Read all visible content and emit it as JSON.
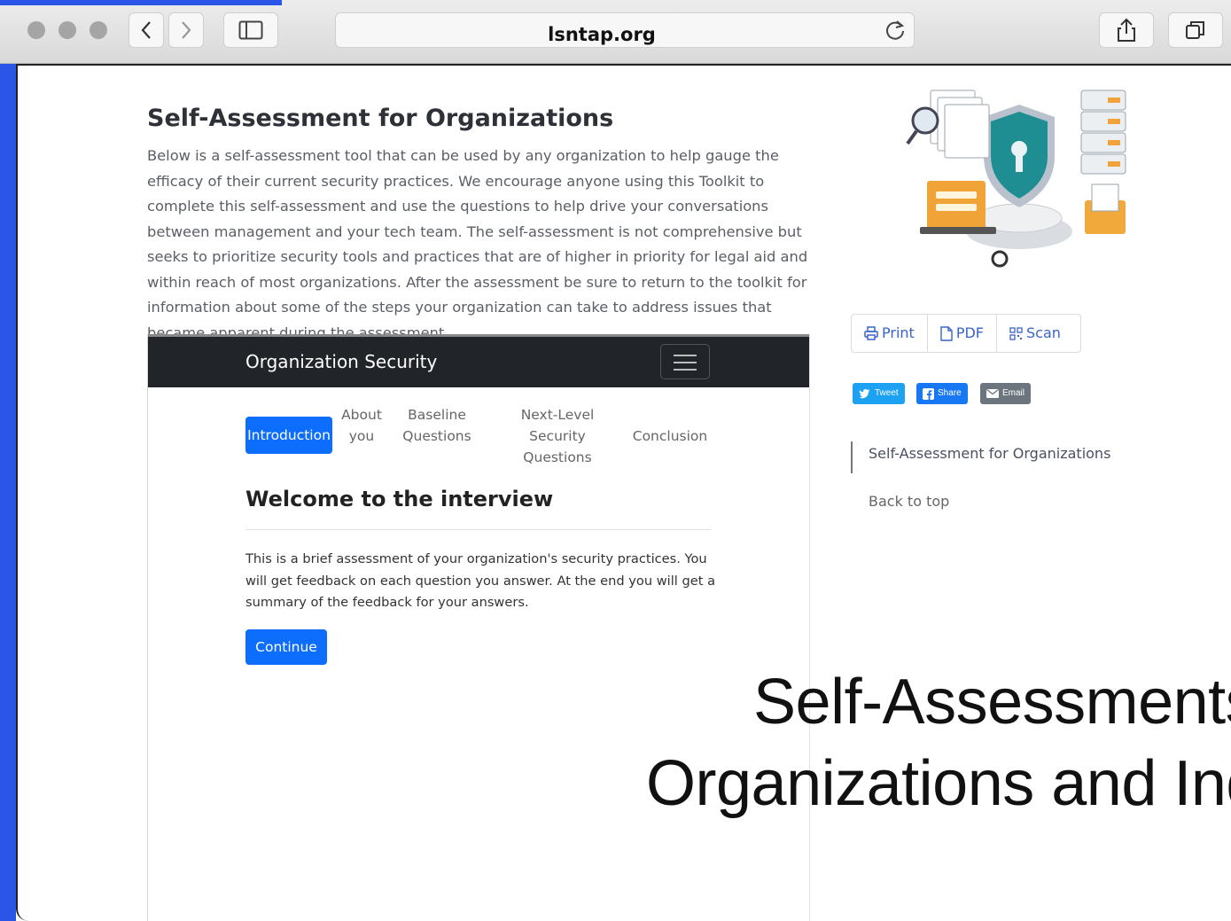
{
  "browser": {
    "url": "lsntap.org"
  },
  "article": {
    "title": "Self-Assessment for Organizations",
    "intro": "Below is a self-assessment tool that can be used by any organization to help gauge the efficacy of their current security practices. We encourage anyone using this Toolkit to complete this self-assessment and use the questions to help drive your conversations between management and your tech team. The self-assessment is not comprehensive but seeks to prioritize security tools and practices that are of higher in priority for legal aid and within reach of most organizations. After the assessment be sure to return to the toolkit for information about some of the steps your organization can take to address issues that became apparent during the assessment."
  },
  "interview": {
    "nav_title": "Organization Security",
    "steps": {
      "introduction": "Introduction",
      "about_1": "About",
      "about_2": "you",
      "baseline_1": "Baseline",
      "baseline_2": "Questions",
      "next_1": "Next-Level Security",
      "next_2": "Questions",
      "conclusion": "Conclusion"
    },
    "heading": "Welcome to the interview",
    "body": "This is a brief assessment of your organization's security practices. You will get feedback on each question you answer. At the end you will get a summary of the feedback for your answers.",
    "continue_label": "Continue"
  },
  "sidebar": {
    "tools": {
      "print": "Print",
      "pdf": "PDF",
      "scan": "Scan"
    },
    "social": {
      "tweet": "Tweet",
      "share": "Share",
      "email": "Email"
    },
    "toc_item": "Self-Assessment for Organizations",
    "back_to_top": "Back to top"
  },
  "overlay": {
    "line1": "Self-Assessments",
    "line2": "Organizations and Ind"
  },
  "colors": {
    "accent": "#2a55e6",
    "button": "#0d6efd",
    "nav_dark": "#212529",
    "twitter": "#1da1f2",
    "facebook": "#1877f2",
    "email": "#6c757d"
  }
}
